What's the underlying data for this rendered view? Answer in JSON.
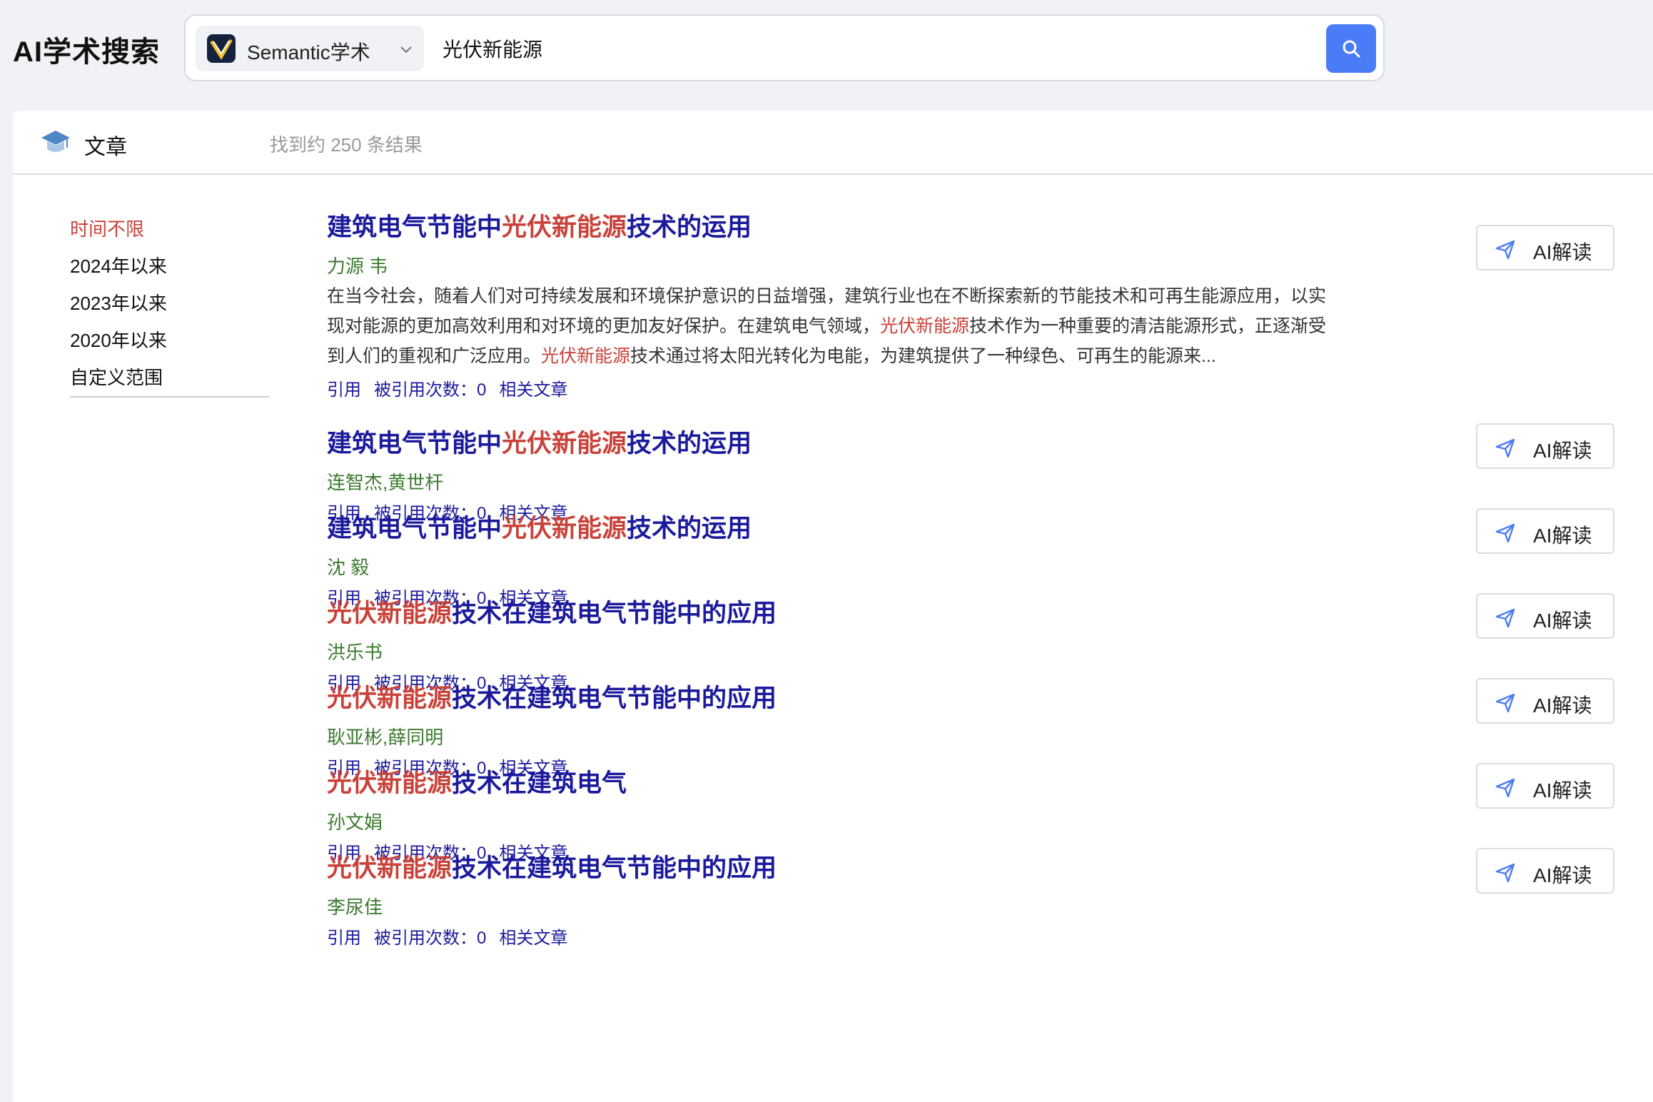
{
  "header": {
    "app_title": "AI学术搜索",
    "engine_label": "Semantic学术",
    "query": "光伏新能源"
  },
  "panel": {
    "section_label": "文章",
    "result_count": "找到约 250 条结果"
  },
  "filters": {
    "items": [
      "时间不限",
      "2024年以来",
      "2023年以来",
      "2020年以来",
      "自定义范围"
    ],
    "active_index": 0
  },
  "actions": {
    "cite": "引用",
    "cited_by": "被引用次数：0",
    "related": "相关文章",
    "ai_read": "AI解读"
  },
  "results": [
    {
      "title_pre": "建筑电气节能中",
      "title_hl": "光伏新能源",
      "title_post": "技术的运用",
      "authors": "力源 韦",
      "abstract": [
        {
          "t": "在当今社会，随着人们对可持续发展和环境保护意识的日益增强，建筑行业也在不断探索新的节能技术和可再生能源应用，以实现对能源的更加高效利用和对环境的更加友好保护。在建筑电气领域，",
          "hl": false
        },
        {
          "t": "光伏新能源",
          "hl": true
        },
        {
          "t": "技术作为一种重要的清洁能源形式，正逐渐受到人们的重视和广泛应用。",
          "hl": false
        },
        {
          "t": "光伏新能源",
          "hl": true
        },
        {
          "t": "技术通过将太阳光转化为电能，为建筑提供了一种绿色、可再生的能源来...",
          "hl": false
        }
      ]
    },
    {
      "title_pre": "建筑电气节能中",
      "title_hl": "光伏新能源",
      "title_post": "技术的运用",
      "authors": "连智杰,黄世杆"
    },
    {
      "title_pre": "建筑电气节能中",
      "title_hl": "光伏新能源",
      "title_post": "技术的运用",
      "authors": "沈 毅"
    },
    {
      "title_pre": "",
      "title_hl": "光伏新能源",
      "title_post": "技术在建筑电气节能中的应用",
      "authors": "洪乐书"
    },
    {
      "title_pre": "",
      "title_hl": "光伏新能源",
      "title_post": "技术在建筑电气节能中的应用",
      "authors": "耿亚彬,薛同明"
    },
    {
      "title_pre": "",
      "title_hl": "光伏新能源",
      "title_post": "技术在建筑电气",
      "authors": "孙文娟"
    },
    {
      "title_pre": "",
      "title_hl": "光伏新能源",
      "title_post": "技术在建筑电气节能中的应用",
      "authors": "李尿佳"
    }
  ],
  "colors": {
    "accent": "#4a7cf7",
    "title": "#1c1a9c",
    "highlight": "#c9423a",
    "author": "#3b7a2e"
  }
}
